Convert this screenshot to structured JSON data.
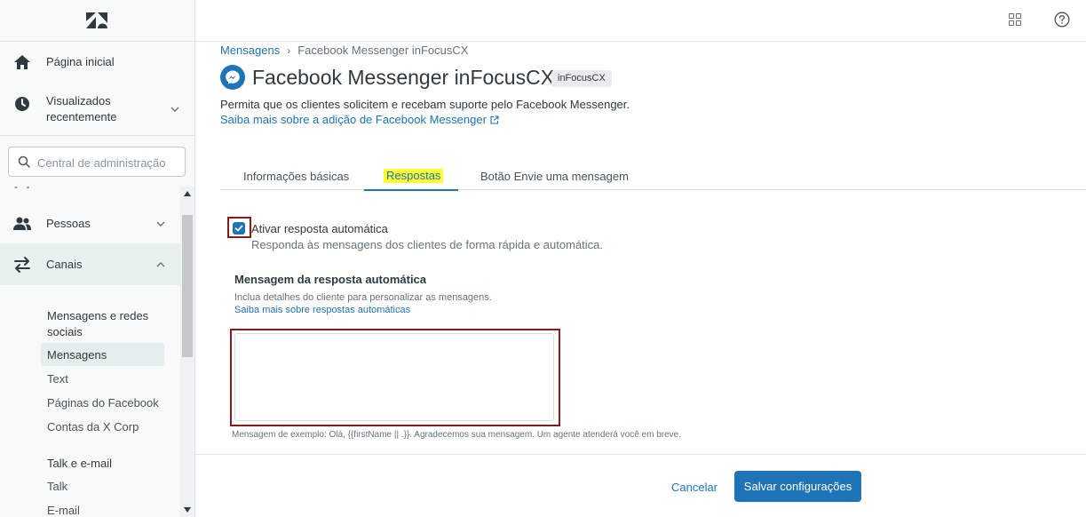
{
  "sidebar": {
    "logo": "zendesk-logo",
    "home_label": "Página inicial",
    "recent_label": "Visualizados recentemente",
    "search_placeholder": "Central de administração",
    "dashes": "- -",
    "people_label": "Pessoas",
    "channels_label": "Canais",
    "messaging_section": "Mensagens e redes sociais",
    "messaging_items": [
      "Mensagens",
      "Text",
      "Páginas do Facebook",
      "Contas da X Corp"
    ],
    "talk_section": "Talk e e-mail",
    "talk_items": [
      "Talk",
      "E-mail"
    ]
  },
  "topbar": {
    "apps_icon": "grid-icon",
    "help_icon": "help-circle-icon"
  },
  "breadcrumb": {
    "parent": "Mensagens",
    "current": "Facebook Messenger inFocusCX"
  },
  "header": {
    "title": "Facebook Messenger inFocusCX",
    "badge": "inFocusCX",
    "description": "Permita que os clientes solicitem e recebam suporte pelo Facebook Messenger.",
    "learn_more": "Saiba mais sobre a adição de Facebook Messenger"
  },
  "tabs": [
    {
      "label": "Informações básicas",
      "active": false
    },
    {
      "label": "Respostas",
      "active": true
    },
    {
      "label": "Botão Envie uma mensagem",
      "active": false
    }
  ],
  "auto_reply": {
    "checked": true,
    "label": "Ativar resposta automática",
    "hint": "Responda às mensagens dos clientes de forma rápida e automática.",
    "message_label": "Mensagem da resposta automática",
    "message_hint": "Inclua detalhes do cliente para personalizar as mensagens.",
    "message_link": "Saiba mais sobre respostas automáticas",
    "message_value": "",
    "example": "Mensagem de exemplo: Olá, {{firstName || .}}. Agradecemos sua mensagem. Um agente atenderá você em breve."
  },
  "footer": {
    "cancel_label": "Cancelar",
    "save_label": "Salvar configurações"
  },
  "colors": {
    "accent": "#1f73b7",
    "highlight": "#ffff33",
    "outline": "#8b1a1a"
  }
}
